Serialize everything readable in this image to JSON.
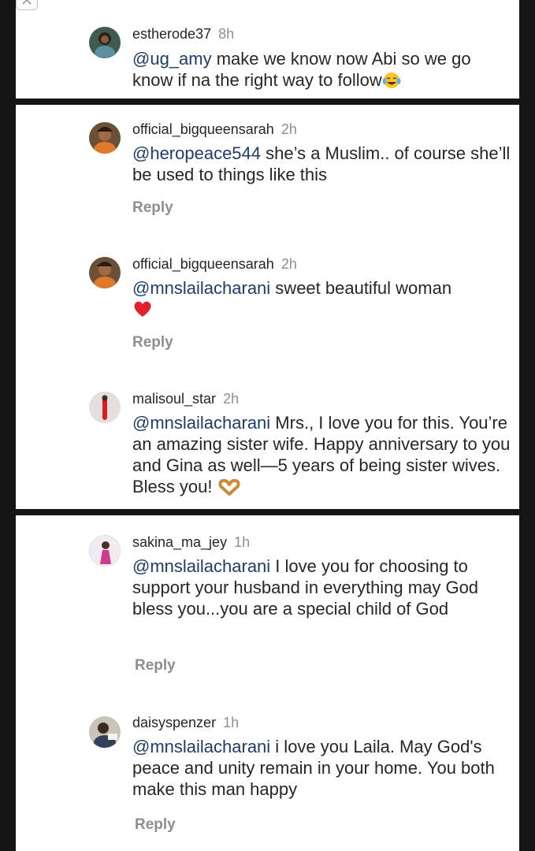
{
  "comments": [
    {
      "username": "estherode37",
      "time": "8h",
      "mention": "@ug_amy",
      "text": " make we know now Abi so we go know if na the right way to follow",
      "emoji": "face-with-tears-of-joy",
      "avatar_color": "#4a6b5a"
    },
    {
      "username": "official_bigqueensarah",
      "time": "2h",
      "mention": "@heropeace544",
      "text": " she’s a Muslim.. of course she’ll be used to things like this",
      "reply": "Reply",
      "avatar_color": "#7a5230"
    },
    {
      "username": "official_bigqueensarah",
      "time": "2h",
      "mention": "@mnslailacharani",
      "text": " sweet beautiful woman",
      "emoji": "red-heart",
      "reply": "Reply",
      "avatar_color": "#7a5230"
    },
    {
      "username": "malisoul_star",
      "time": "2h",
      "mention": "@mnslailacharani",
      "text": " Mrs., I love you for this. You’re an amazing sister wife. Happy anniversary to you and Gina as well—5 years of being sister wives. Bless you!",
      "emoji": "heart-hands",
      "avatar_color": "#d6d0cc"
    },
    {
      "username": "sakina_ma_jey",
      "time": "1h",
      "mention": "@mnslailacharani",
      "text": " I love you for choosing to support your husband in everything may God bless you...you are a special child of God",
      "reply": "Reply",
      "avatar_color": "#e9e4ea"
    },
    {
      "username": "daisyspenzer",
      "time": "1h",
      "mention": "@mnslailacharani",
      "text": " i love you Laila. May God's peace and unity remain in your home. You both make this man happy",
      "reply": "Reply",
      "avatar_color": "#3f4a5e"
    }
  ],
  "colors": {
    "background": "#151515",
    "panel": "#ffffff",
    "username": "#262626",
    "timestamp": "#8e8e8e",
    "mention": "#1f3d66"
  }
}
